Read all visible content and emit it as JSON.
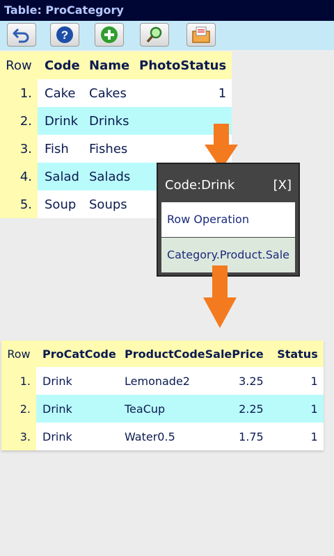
{
  "window": {
    "title": "Table: ProCategory"
  },
  "toolbar": {
    "buttons": [
      {
        "icon": "undo-arrow-icon"
      },
      {
        "icon": "help-icon"
      },
      {
        "icon": "add-icon"
      },
      {
        "icon": "search-icon"
      },
      {
        "icon": "report-icon"
      }
    ]
  },
  "table1": {
    "headers": {
      "row": "Row",
      "code": "Code",
      "name": "Name",
      "photo": "Photo",
      "status": "Status"
    },
    "rows": [
      {
        "num": "1.",
        "code": "Cake",
        "name": "Cakes",
        "photo": "",
        "status": "1"
      },
      {
        "num": "2.",
        "code": "Drink",
        "name": "Drinks",
        "photo": "",
        "status": ""
      },
      {
        "num": "3.",
        "code": "Fish",
        "name": "Fishes",
        "photo": "",
        "status": ""
      },
      {
        "num": "4.",
        "code": "Salad",
        "name": "Salads",
        "photo": "",
        "status": ""
      },
      {
        "num": "5.",
        "code": "Soup",
        "name": "Soups",
        "photo": "",
        "status": ""
      }
    ]
  },
  "popup": {
    "title": "Code:Drink",
    "close": "[X]",
    "items": [
      "Row Operation",
      "Category.Product.Sale"
    ]
  },
  "table2": {
    "headers": {
      "row": "Row",
      "procatcode": "ProCatCode",
      "productcode": "ProductCode",
      "saleprice": "SalePrice",
      "status": "Status"
    },
    "rows": [
      {
        "num": "1.",
        "procatcode": "Drink",
        "productcode": "Lemonade2",
        "saleprice": "3.25",
        "status": "1"
      },
      {
        "num": "2.",
        "procatcode": "Drink",
        "productcode": "TeaCup",
        "saleprice": "2.25",
        "status": "1"
      },
      {
        "num": "3.",
        "procatcode": "Drink",
        "productcode": "Water0.5",
        "saleprice": "1.75",
        "status": "1"
      }
    ]
  },
  "colors": {
    "titlebar_bg": "#000633",
    "titlebar_text": "#b5c8ff",
    "toolbar_bg": "#c5e9f7",
    "header_row_bg": "#fffbb0",
    "alt_row_bg": "#b9fbfb",
    "arrow": "#f47a1f"
  }
}
